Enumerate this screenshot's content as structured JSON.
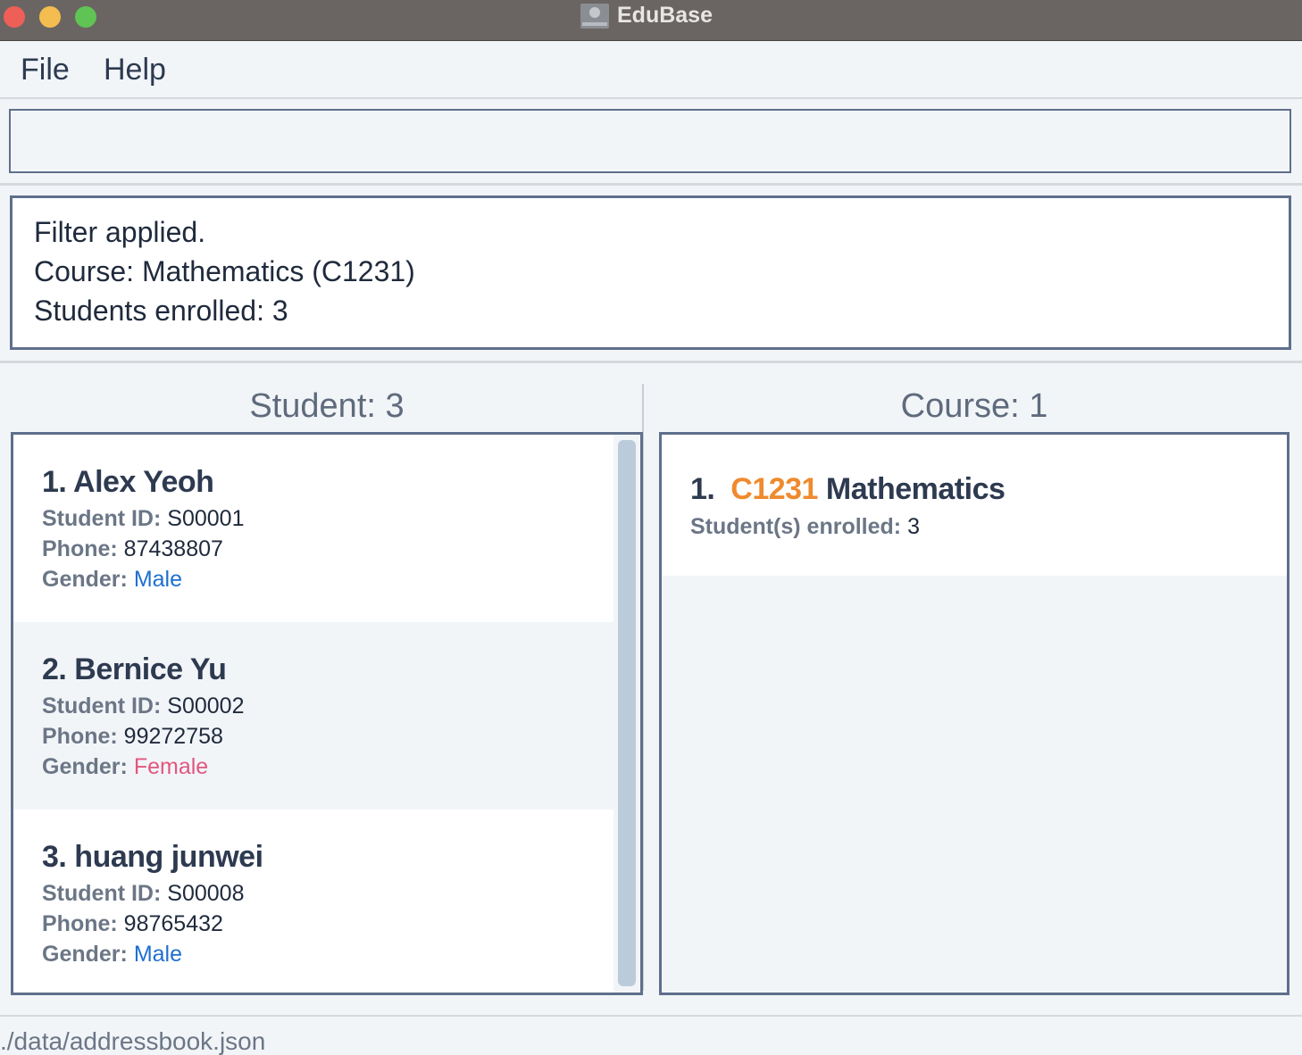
{
  "window": {
    "title": "EduBase"
  },
  "menu": {
    "file": "File",
    "help": "Help"
  },
  "command": {
    "value": ""
  },
  "result": {
    "line1": "Filter applied.",
    "line2": "Course: Mathematics (C1231)",
    "line3": "Students enrolled: 3"
  },
  "students": {
    "title": "Student: 3",
    "labels": {
      "id": "Student ID:",
      "phone": "Phone:",
      "gender": "Gender:"
    },
    "items": [
      {
        "name": "1.  Alex Yeoh",
        "id": "S00001",
        "phone": "87438807",
        "gender": "Male"
      },
      {
        "name": "2.  Bernice Yu",
        "id": "S00002",
        "phone": "99272758",
        "gender": "Female"
      },
      {
        "name": "3.  huang junwei",
        "id": "S00008",
        "phone": "98765432",
        "gender": "Male"
      }
    ]
  },
  "courses": {
    "title": "Course: 1",
    "items": [
      {
        "index": "1.",
        "code": "C1231",
        "name": "Mathematics",
        "enrolled_label": "Student(s) enrolled:",
        "enrolled": "3"
      }
    ]
  },
  "status": {
    "path": "./data/addressbook.json"
  },
  "colors": {
    "male": "#1f6fd1",
    "female": "#e1577f",
    "course_code": "#ef8a2e",
    "border": "#5f6f8c"
  }
}
